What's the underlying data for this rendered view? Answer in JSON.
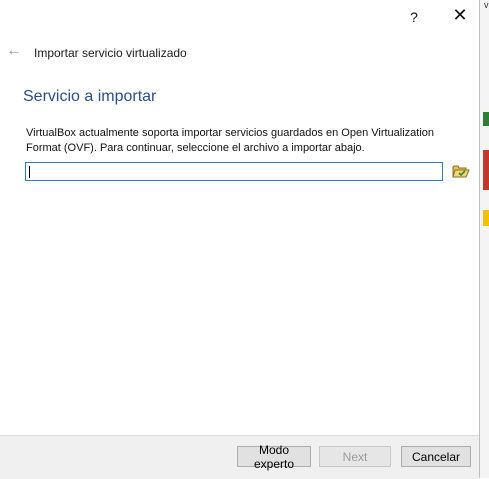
{
  "titlebar": {
    "help_label": "?",
    "close_label": "✕"
  },
  "wizard": {
    "back_label": "←",
    "window_title": "Importar servicio virtualizado",
    "heading": "Servicio a importar",
    "description": "VirtualBox actualmente soporta importar servicios guardados en Open Virtualization Format (OVF). Para continuar, seleccione el archivo a importar abajo.",
    "file_input_value": "",
    "browse_icon": "folder-open-icon"
  },
  "footer": {
    "expert_label": "Modo experto",
    "next_label": "Next",
    "cancel_label": "Cancelar",
    "next_enabled": false
  },
  "right_edge": {
    "text": "v"
  }
}
